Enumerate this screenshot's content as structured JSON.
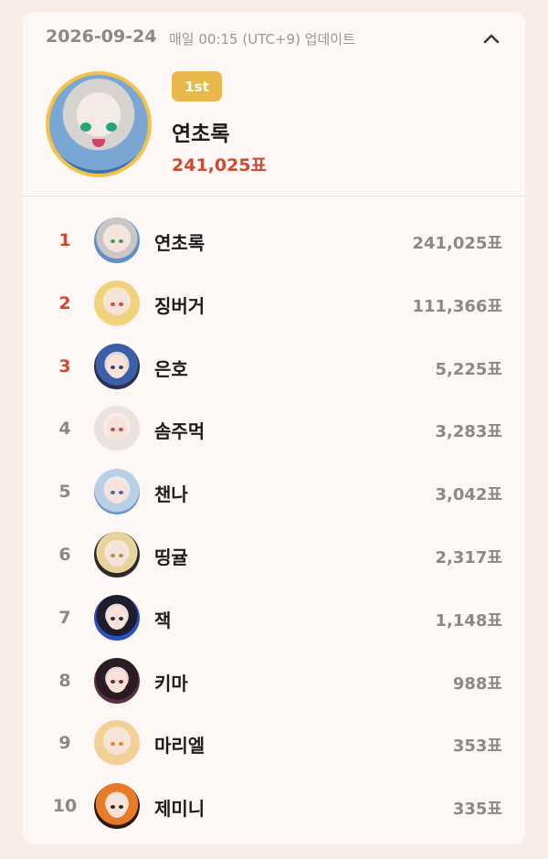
{
  "header": {
    "date": "2026-09-24",
    "update_text": "매일 00:15 (UTC+9) 업데이트",
    "toggle_icon": "chevron-up-icon"
  },
  "top": {
    "badge": "1st",
    "name": "연초록",
    "votes": "241,025표"
  },
  "colors": {
    "top3_rank": "#cf4a33",
    "badge": "#e8b84a",
    "muted": "#8e8884"
  },
  "ranking": [
    {
      "rank": "1",
      "name": "연초록",
      "votes": "241,025표"
    },
    {
      "rank": "2",
      "name": "징버거",
      "votes": "111,366표"
    },
    {
      "rank": "3",
      "name": "은호",
      "votes": "5,225표"
    },
    {
      "rank": "4",
      "name": "솜주먹",
      "votes": "3,283표"
    },
    {
      "rank": "5",
      "name": "챈나",
      "votes": "3,042표"
    },
    {
      "rank": "6",
      "name": "띵귤",
      "votes": "2,317표"
    },
    {
      "rank": "7",
      "name": "잭",
      "votes": "1,148표"
    },
    {
      "rank": "8",
      "name": "키마",
      "votes": "988표"
    },
    {
      "rank": "9",
      "name": "마리엘",
      "votes": "353표"
    },
    {
      "rank": "10",
      "name": "제미니",
      "votes": "335표"
    }
  ]
}
